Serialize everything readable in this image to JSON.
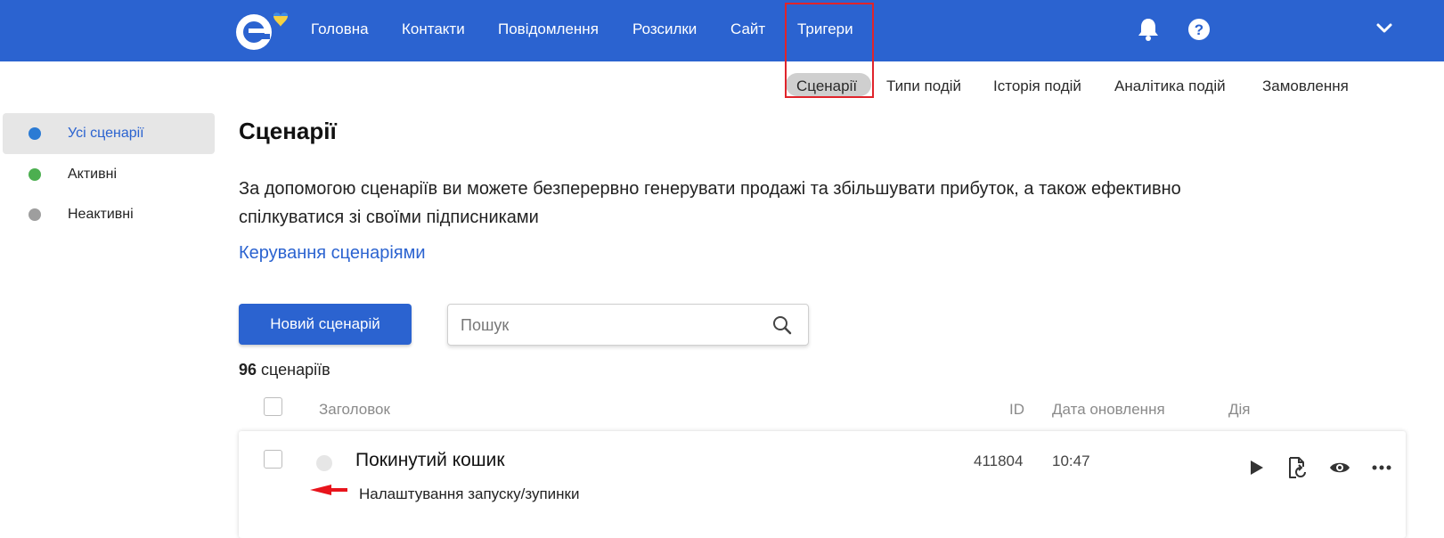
{
  "colors": {
    "brand": "#2b63d0",
    "active_dot": "#2b7bd4",
    "green_dot": "#4caf50",
    "gray_dot": "#9e9e9e",
    "highlight": "#e0242b"
  },
  "topnav": {
    "items": [
      "Головна",
      "Контакти",
      "Повідомлення",
      "Розсилки",
      "Сайт",
      "Тригери"
    ],
    "active": "Тригери",
    "icons": [
      "bell-icon",
      "help-icon",
      "chevron-down-icon"
    ]
  },
  "subnav": {
    "items": [
      "Сценарії",
      "Типи подій",
      "Історія подій",
      "Аналітика подій",
      "Замовлення"
    ],
    "active": "Сценарії"
  },
  "sidebar": {
    "items": [
      {
        "label": "Усі сценарії"
      },
      {
        "label": "Активні"
      },
      {
        "label": "Неактивні"
      }
    ]
  },
  "main": {
    "title": "Сценарії",
    "description": "За допомогою сценаріїв ви можете безперервно генерувати продажі та збільшувати прибуток, а також ефективно спілкуватися зі своїми підписниками",
    "manage_link": "Керування сценаріями",
    "new_button": "Новий сценарій",
    "search_placeholder": "Пошук",
    "count_number": "96",
    "count_label": "сценаріїв"
  },
  "table": {
    "headers": {
      "title": "Заголовок",
      "id": "ID",
      "updated": "Дата оновлення",
      "action": "Дія"
    },
    "rows": [
      {
        "title": "Покинутий кошик",
        "subtitle": "Налаштування запуску/зупинки",
        "id": "411804",
        "updated": "10:47"
      }
    ]
  }
}
